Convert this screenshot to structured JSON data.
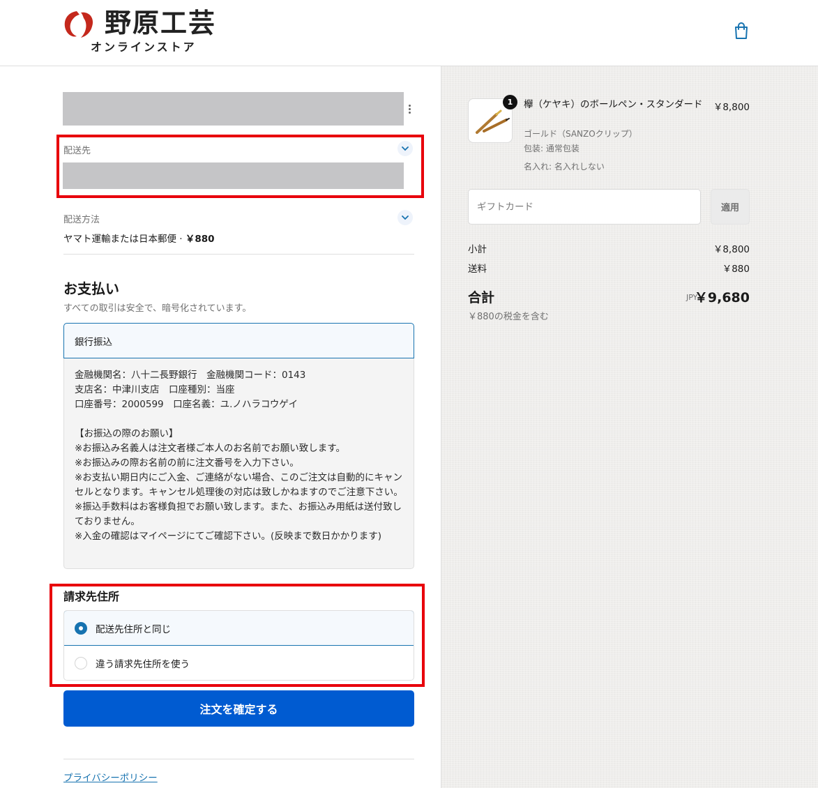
{
  "store": {
    "name": "野原工芸",
    "subtitle": "オンラインストア"
  },
  "header": {
    "cart_icon": "shopping-bag-icon"
  },
  "shipping_address": {
    "label": "配送先"
  },
  "shipping_method": {
    "label": "配送方法",
    "value": "ヤマト運輸または日本郵便 · ",
    "price": "￥880"
  },
  "payment": {
    "title": "お支払い",
    "subtitle": "すべての取引は安全で、暗号化されています。",
    "method_label": "銀行振込",
    "details": [
      "金融機関名：八十二長野銀行　金融機関コード：0143",
      "支店名：中津川支店　口座種別：当座",
      "口座番号：2000599　口座名義：ユ.ノハラコウゲイ",
      "",
      "【お振込の際のお願い】",
      "※お振込み名義人は注文者様ご本人のお名前でお願い致します。",
      "※お振込みの際お名前の前に注文番号を入力下さい。",
      "※お支払い期日内にご入金、ご連絡がない場合、このご注文は自動的にキャンセルとなります。キャンセル処理後の対応は致しかねますのでご注意下さい。",
      "※振込手数料はお客様負担でお願い致します。また、お振込み用紙は送付致しておりません。",
      "※入金の確認はマイページにてご確認下さい。(反映まで数日かかります)"
    ]
  },
  "billing": {
    "title": "請求先住所",
    "same_label": "配送先住所と同じ",
    "different_label": "違う請求先住所を使う"
  },
  "submit_label": "注文を確定する",
  "privacy_label": "プライバシーポリシー",
  "order": {
    "quantity": "1",
    "product_name": "欅（ケヤキ）のボールペン・スタンダード",
    "product_price": "￥8,800",
    "variant": "ゴールド（SANZOクリップ）",
    "wrapping": "包装: 通常包装",
    "engraving": "名入れ: 名入れしない",
    "gift_placeholder": "ギフトカード",
    "apply_label": "適用",
    "subtotal_label": "小計",
    "subtotal_value": "￥8,800",
    "shipping_label": "送料",
    "shipping_value": "￥880",
    "total_label": "合計",
    "total_currency": "JPY",
    "total_value": "￥9,680",
    "tax_note": "￥880の税金を含む"
  },
  "colors": {
    "accent": "#005bd1",
    "link": "#1773b0",
    "highlight": "#e8000b"
  }
}
